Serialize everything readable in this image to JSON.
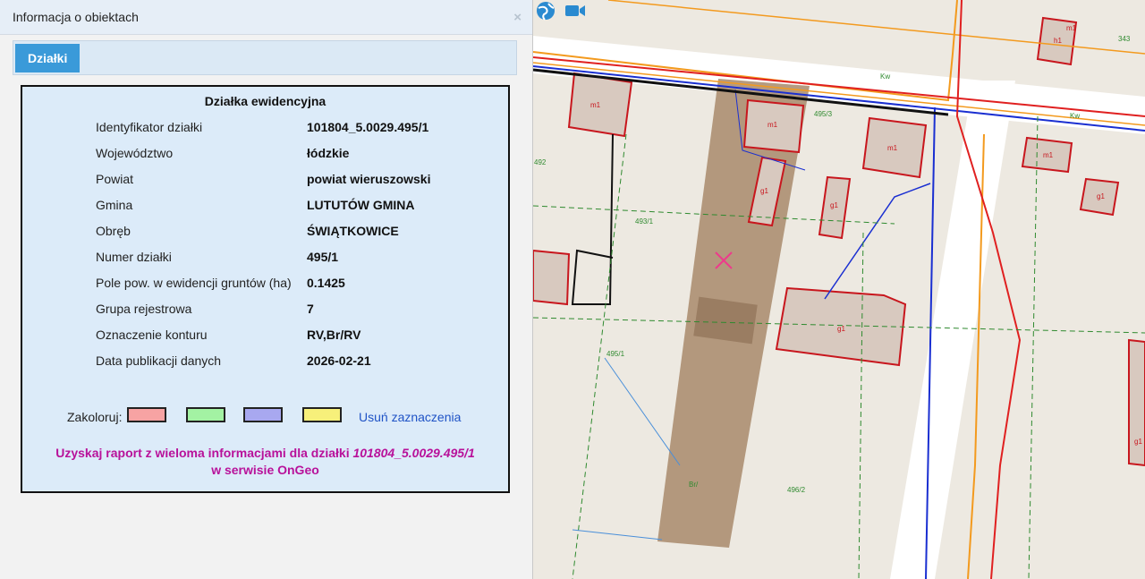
{
  "panel": {
    "title": "Informacja o obiektach",
    "close_symbol": "×",
    "tabs": [
      {
        "label": "Działki"
      }
    ]
  },
  "parcel": {
    "section_title": "Działka ewidencyjna",
    "fields": [
      {
        "label": "Identyfikator działki",
        "value": "101804_5.0029.495/1"
      },
      {
        "label": "Województwo",
        "value": "łódzkie"
      },
      {
        "label": "Powiat",
        "value": "powiat wieruszowski"
      },
      {
        "label": "Gmina",
        "value": "LUTUTÓW GMINA"
      },
      {
        "label": "Obręb",
        "value": "ŚWIĄTKOWICE"
      },
      {
        "label": "Numer działki",
        "value": "495/1"
      },
      {
        "label": "Pole pow. w ewidencji gruntów (ha)",
        "value": "0.1425"
      },
      {
        "label": "Grupa rejestrowa",
        "value": "7"
      },
      {
        "label": "Oznaczenie konturu",
        "value": "RV,Br/RV"
      },
      {
        "label": "Data publikacji danych",
        "value": "2026-02-21"
      }
    ]
  },
  "colorize": {
    "label": "Zakoloruj:",
    "swatches": [
      "#f7a3a3",
      "#a3f2a3",
      "#a8a8f0",
      "#f7f07a"
    ],
    "clear_label": "Usuń zaznaczenia"
  },
  "report": {
    "prefix": "Uzyskaj raport z wieloma informacjami dla działki",
    "parcel_id": "101804_5.0029.495/1",
    "line2": "w serwisie OnGeo"
  },
  "map": {
    "toolbar_icons": [
      "globe-icon",
      "video-camera-icon"
    ],
    "labels": [
      "m1",
      "m1",
      "m1",
      "m1",
      "m1",
      "h1",
      "g1",
      "g1",
      "g1",
      "g1",
      "g1",
      "495/3",
      "493/1",
      "495/1",
      "496/2",
      "492",
      "343",
      "Br/",
      "Kw",
      "Kw"
    ],
    "colors": {
      "parcel_fill": "#a8896b",
      "building_fill": "#d8c9bf",
      "building_stroke": "#c8161d",
      "road": "#ffffff",
      "gas": "#f39a1e",
      "water": "#1a2fd1",
      "boundary": "#2f8a2f"
    }
  }
}
